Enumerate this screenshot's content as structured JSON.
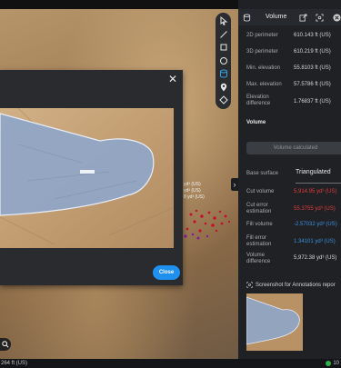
{
  "panel": {
    "title": "Volume",
    "measures": [
      {
        "label": "2D perimeter",
        "value": "610.143 ft (US)"
      },
      {
        "label": "3D perimeter",
        "value": "610.219 ft (US)"
      },
      {
        "label": "Min. elevation",
        "value": "55.8103 ft (US)"
      },
      {
        "label": "Max. elevation",
        "value": "57.5786 ft (US)"
      },
      {
        "label": "Elevation difference",
        "value": "1.76837 ft (US)"
      }
    ],
    "section_volume": "Volume",
    "volume_calc_button": "Volume calculated",
    "base_surface_label": "Base surface",
    "base_surface_value": "Triangulated",
    "volumes": [
      {
        "label": "Cut volume",
        "value": "5,914.95 yd³ (US)",
        "color": "#e03a3a"
      },
      {
        "label": "Cut error estimation",
        "value": "55.3755 yd³ (US)",
        "color": "#e03a3a"
      },
      {
        "label": "Fill volume",
        "value": "-2.57032 yd³ (US)",
        "color": "#3c8fe0"
      },
      {
        "label": "Fill error estimation",
        "value": "1.34101 yd³ (US)",
        "color": "#3c8fe0"
      },
      {
        "label": "Volume difference",
        "value": "5,972.38 yd³ (US)",
        "color": "#d6d6d6"
      }
    ],
    "screenshot_label": "Screenshot for Annotations repor"
  },
  "modal": {
    "close_label": "Close",
    "close_icon": "close-icon",
    "background_labels": [
      "yd³ (US)",
      "yd³ (US)",
      "8 yd³ (US)"
    ]
  },
  "toolbar": {
    "icons": [
      "cursor-icon",
      "line-icon",
      "polygon-icon",
      "circle-icon",
      "volume-icon",
      "pin-icon",
      "shape-icon"
    ],
    "active": "volume-icon"
  },
  "statusbar": {
    "left_text": "264 ft (US)",
    "right_text": "10"
  },
  "colors": {
    "accent": "#1f8ff0",
    "cut": "#e03a3a",
    "fill": "#3c8fe0",
    "panel_bg": "#1f2124"
  }
}
